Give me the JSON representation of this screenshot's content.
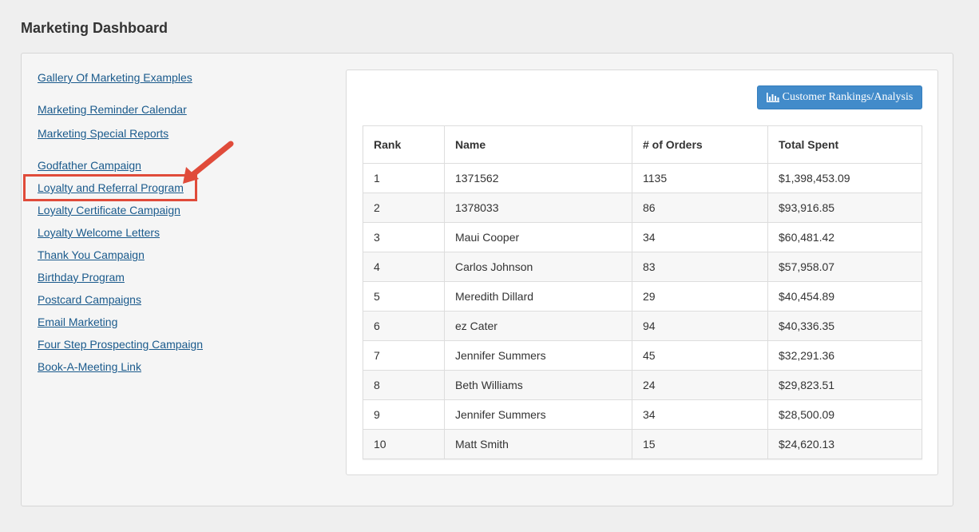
{
  "page": {
    "title": "Marketing Dashboard"
  },
  "sidebar": {
    "links": [
      {
        "label": "Gallery Of Marketing Examples"
      },
      {
        "label": "Marketing Reminder Calendar"
      },
      {
        "label": "Marketing Special Reports"
      },
      {
        "label": "Godfather Campaign"
      },
      {
        "label": "Loyalty and Referral Program",
        "highlighted": true
      },
      {
        "label": "Loyalty Certificate Campaign"
      },
      {
        "label": "Loyalty Welcome Letters"
      },
      {
        "label": "Thank You Campaign"
      },
      {
        "label": "Birthday Program"
      },
      {
        "label": "Postcard Campaigns"
      },
      {
        "label": "Email Marketing"
      },
      {
        "label": "Four Step Prospecting Campaign"
      },
      {
        "label": "Book-A-Meeting Link"
      }
    ]
  },
  "rankings": {
    "button_label": "Customer Rankings/Analysis",
    "button_icon": "bar-chart-icon",
    "columns": [
      "Rank",
      "Name",
      "# of Orders",
      "Total Spent"
    ],
    "rows": [
      [
        "1",
        "1371562",
        "1135",
        "$1,398,453.09"
      ],
      [
        "2",
        "1378033",
        "86",
        "$93,916.85"
      ],
      [
        "3",
        "Maui Cooper",
        "34",
        "$60,481.42"
      ],
      [
        "4",
        "Carlos Johnson",
        "83",
        "$57,958.07"
      ],
      [
        "5",
        "Meredith Dillard",
        "29",
        "$40,454.89"
      ],
      [
        "6",
        "ez Cater",
        "94",
        "$40,336.35"
      ],
      [
        "7",
        "Jennifer Summers",
        "45",
        "$32,291.36"
      ],
      [
        "8",
        "Beth Williams",
        "24",
        "$29,823.51"
      ],
      [
        "9",
        "Jennifer Summers",
        "34",
        "$28,500.09"
      ],
      [
        "10",
        "Matt Smith",
        "15",
        "$24,620.13"
      ]
    ]
  },
  "colors": {
    "link": "#1a5a8c",
    "button": "#428bca",
    "annotation": "#e04b3a"
  }
}
